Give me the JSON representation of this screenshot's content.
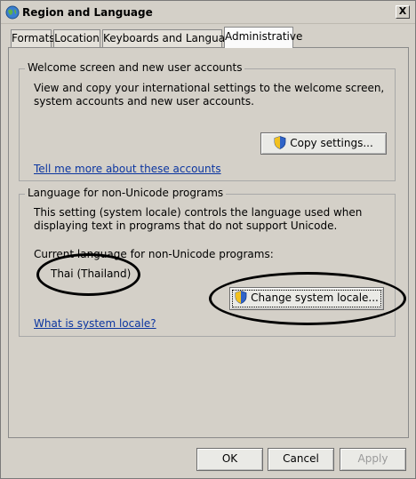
{
  "window": {
    "title": "Region and Language",
    "close_glyph": "X"
  },
  "tabs": [
    {
      "label": "Formats"
    },
    {
      "label": "Location"
    },
    {
      "label": "Keyboards and Languages"
    },
    {
      "label": "Administrative"
    }
  ],
  "welcome_group": {
    "title": "Welcome screen and new user accounts",
    "description": "View and copy your international settings to the welcome screen, system accounts and new user accounts.",
    "copy_button": "Copy settings...",
    "link": "Tell me more about these accounts"
  },
  "nonunicode_group": {
    "title": "Language for non-Unicode programs",
    "description": "This setting (system locale) controls the language used when displaying text in programs that do not support Unicode.",
    "current_label": "Current language for non-Unicode programs:",
    "current_value": "Thai (Thailand)",
    "change_button": "Change system locale...",
    "link": "What is system locale?"
  },
  "footer": {
    "ok": "OK",
    "cancel": "Cancel",
    "apply": "Apply"
  },
  "colors": {
    "link": "#0b35a0",
    "dialog_bg": "#d4d0c8"
  },
  "icons": {
    "app": "globe-icon",
    "uac": "uac-shield-icon"
  }
}
